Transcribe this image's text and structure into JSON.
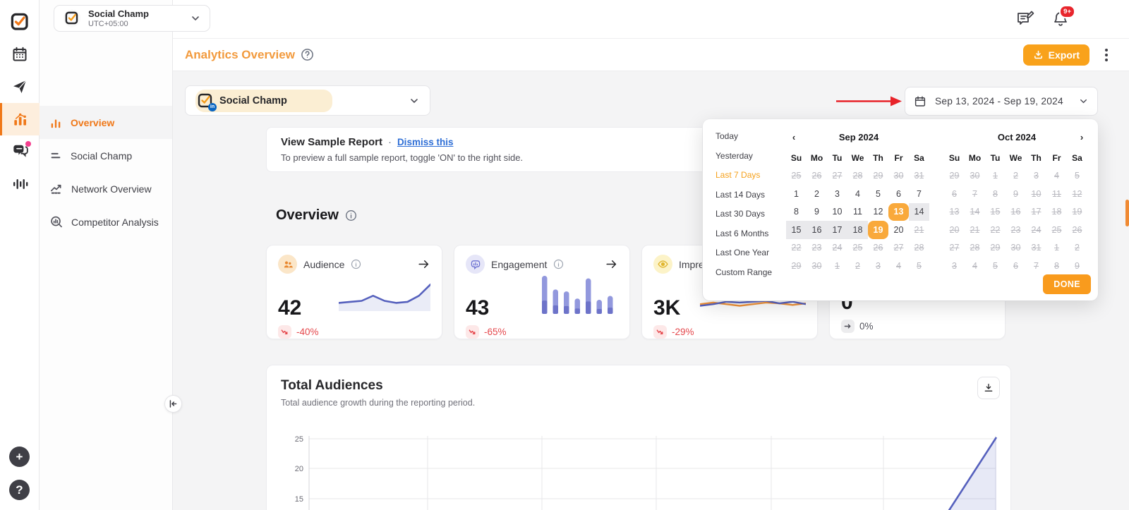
{
  "colors": {
    "accent_orange": "#F9A21B",
    "deep_orange": "#F07818",
    "title_orange": "#F29A3D",
    "negative_red": "#E5484D",
    "annotation_red": "#E8232A",
    "link_blue": "#2F6FD6",
    "chart_indigo": "#5560BD",
    "selected_day_orange": "#F9A93B",
    "range_gray": "#E9E9EC",
    "badge_red": "#E8252C"
  },
  "topbar": {
    "account": {
      "name": "Social Champ",
      "timezone": "UTC+05:00"
    },
    "icons": [
      {
        "name": "compose-icon",
        "badge": ""
      },
      {
        "name": "bell-icon",
        "badge": "9+"
      }
    ]
  },
  "rail": {
    "items": [
      {
        "icon": "logo-icon",
        "active": false,
        "dot": false
      },
      {
        "icon": "calendar-icon",
        "active": false,
        "dot": false
      },
      {
        "icon": "send-icon",
        "active": false,
        "dot": false
      },
      {
        "icon": "analytics-icon",
        "active": true,
        "dot": false
      },
      {
        "icon": "messages-icon",
        "active": false,
        "dot": true
      },
      {
        "icon": "waveform-icon",
        "active": false,
        "dot": false
      }
    ],
    "bottom": [
      {
        "icon": "plus-icon",
        "glyph": "+"
      },
      {
        "icon": "help-icon",
        "glyph": "?"
      }
    ]
  },
  "sidebar": {
    "items": [
      {
        "label": "Overview",
        "icon": "bars",
        "active": true
      },
      {
        "label": "Social Champ",
        "icon": "lines",
        "active": false
      },
      {
        "label": "Network Overview",
        "icon": "trend",
        "active": false
      },
      {
        "label": "Competitor Analysis",
        "icon": "scan",
        "active": false
      }
    ]
  },
  "header": {
    "title": "Analytics Overview",
    "export_label": "Export"
  },
  "filters": {
    "profile": {
      "name": "Social Champ",
      "network": "linkedin"
    },
    "date_range": "Sep 13, 2024 - Sep 19, 2024"
  },
  "annotations": {
    "red_arrow_target": "date-range-picker"
  },
  "banner": {
    "title": "View Sample Report",
    "separator": "·",
    "dismiss_label": "Dismiss this",
    "subtitle": "To preview a full sample report, toggle 'ON' to the right side."
  },
  "overview": {
    "heading": "Overview",
    "cards": [
      {
        "title": "Audience",
        "value": "42",
        "trend": "-40%",
        "trend_dir": "down",
        "icon": "audience-icon",
        "spark": "line",
        "spark_values": [
          8,
          9,
          10,
          15,
          10,
          8,
          9,
          15,
          26
        ]
      },
      {
        "title": "Engagement",
        "value": "43",
        "trend": "-65%",
        "trend_dir": "down",
        "icon": "engagement-icon",
        "spark": "bars",
        "spark_values": [
          100,
          58,
          52,
          30,
          92,
          26,
          38
        ]
      },
      {
        "title": "Impressions",
        "value": "3K",
        "trend": "-29%",
        "trend_dir": "down",
        "icon": "impressions-icon",
        "spark": "dual",
        "spark_values": [
          [
            12,
            14,
            12,
            10,
            12,
            14,
            13,
            11,
            13
          ],
          [
            10,
            12,
            15,
            14,
            15,
            16,
            13,
            15,
            12
          ]
        ]
      },
      {
        "title": "",
        "value": "0",
        "trend": "0%",
        "trend_dir": "flat",
        "icon": "",
        "spark": "none",
        "spark_values": []
      }
    ]
  },
  "datepicker": {
    "presets": [
      {
        "label": "Today",
        "active": false
      },
      {
        "label": "Yesterday",
        "active": false
      },
      {
        "label": "Last 7 Days",
        "active": true
      },
      {
        "label": "Last 14 Days",
        "active": false
      },
      {
        "label": "Last 30 Days",
        "active": false
      },
      {
        "label": "Last 6 Months",
        "active": false
      },
      {
        "label": "Last One Year",
        "active": false
      },
      {
        "label": "Custom Range",
        "active": false
      }
    ],
    "weekdays": [
      "Su",
      "Mo",
      "Tu",
      "We",
      "Th",
      "Fr",
      "Sa"
    ],
    "months": [
      {
        "name": "Sep 2024",
        "nav_prev": true,
        "nav_next": false,
        "weeks": [
          [
            [
              "25",
              "x"
            ],
            [
              "26",
              "x"
            ],
            [
              "27",
              "x"
            ],
            [
              "28",
              "x"
            ],
            [
              "29",
              "x"
            ],
            [
              "30",
              "x"
            ],
            [
              "31",
              "x"
            ]
          ],
          [
            [
              "1",
              "n"
            ],
            [
              "2",
              "n"
            ],
            [
              "3",
              "n"
            ],
            [
              "4",
              "n"
            ],
            [
              "5",
              "n"
            ],
            [
              "6",
              "n"
            ],
            [
              "7",
              "n"
            ]
          ],
          [
            [
              "8",
              "n"
            ],
            [
              "9",
              "n"
            ],
            [
              "10",
              "n"
            ],
            [
              "11",
              "n"
            ],
            [
              "12",
              "n"
            ],
            [
              "13",
              "s"
            ],
            [
              "14",
              "r"
            ]
          ],
          [
            [
              "15",
              "r"
            ],
            [
              "16",
              "r"
            ],
            [
              "17",
              "r"
            ],
            [
              "18",
              "r"
            ],
            [
              "19",
              "s"
            ],
            [
              "20",
              "n"
            ],
            [
              "21",
              "x"
            ]
          ],
          [
            [
              "22",
              "x"
            ],
            [
              "23",
              "x"
            ],
            [
              "24",
              "x"
            ],
            [
              "25",
              "x"
            ],
            [
              "26",
              "x"
            ],
            [
              "27",
              "x"
            ],
            [
              "28",
              "x"
            ]
          ],
          [
            [
              "29",
              "x"
            ],
            [
              "30",
              "x"
            ],
            [
              "1",
              "x"
            ],
            [
              "2",
              "x"
            ],
            [
              "3",
              "x"
            ],
            [
              "4",
              "x"
            ],
            [
              "5",
              "x"
            ]
          ]
        ]
      },
      {
        "name": "Oct 2024",
        "nav_prev": false,
        "nav_next": true,
        "weeks": [
          [
            [
              "29",
              "x"
            ],
            [
              "30",
              "x"
            ],
            [
              "1",
              "x"
            ],
            [
              "2",
              "x"
            ],
            [
              "3",
              "x"
            ],
            [
              "4",
              "x"
            ],
            [
              "5",
              "x"
            ]
          ],
          [
            [
              "6",
              "x"
            ],
            [
              "7",
              "x"
            ],
            [
              "8",
              "x"
            ],
            [
              "9",
              "x"
            ],
            [
              "10",
              "x"
            ],
            [
              "11",
              "x"
            ],
            [
              "12",
              "x"
            ]
          ],
          [
            [
              "13",
              "x"
            ],
            [
              "14",
              "x"
            ],
            [
              "15",
              "x"
            ],
            [
              "16",
              "x"
            ],
            [
              "17",
              "x"
            ],
            [
              "18",
              "x"
            ],
            [
              "19",
              "x"
            ]
          ],
          [
            [
              "20",
              "x"
            ],
            [
              "21",
              "x"
            ],
            [
              "22",
              "x"
            ],
            [
              "23",
              "x"
            ],
            [
              "24",
              "x"
            ],
            [
              "25",
              "x"
            ],
            [
              "26",
              "x"
            ]
          ],
          [
            [
              "27",
              "x"
            ],
            [
              "28",
              "x"
            ],
            [
              "29",
              "x"
            ],
            [
              "30",
              "x"
            ],
            [
              "31",
              "x"
            ],
            [
              "1",
              "x"
            ],
            [
              "2",
              "x"
            ]
          ],
          [
            [
              "3",
              "x"
            ],
            [
              "4",
              "x"
            ],
            [
              "5",
              "x"
            ],
            [
              "6",
              "x"
            ],
            [
              "7",
              "x"
            ],
            [
              "8",
              "x"
            ],
            [
              "9",
              "x"
            ]
          ]
        ]
      }
    ],
    "done_label": "DONE"
  },
  "total_audiences": {
    "title": "Total Audiences",
    "subtitle": "Total audience growth during the reporting period."
  },
  "chart_data": {
    "type": "area",
    "title": "Total Audiences",
    "y_ticks_visible": [
      25,
      20,
      15
    ],
    "grid": true,
    "series": [
      {
        "name": "Total Audience",
        "visible_segment": {
          "x_start_frac": 0.93,
          "y_start": 13,
          "x_end_frac": 1.0,
          "y_end": 26
        }
      }
    ]
  }
}
